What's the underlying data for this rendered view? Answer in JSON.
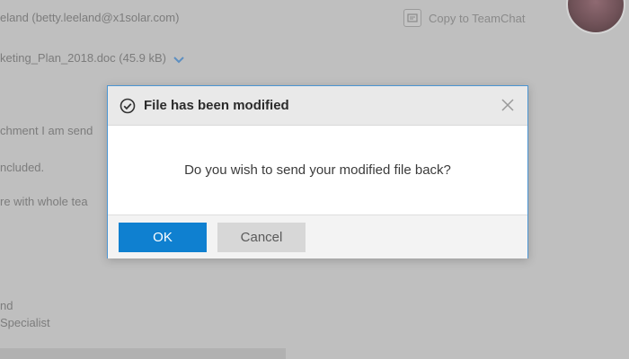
{
  "email": {
    "sender": "eland (betty.leeland@x1solar.com)",
    "copy_to_teamchat_label": "Copy to TeamChat",
    "attachment": "keting_Plan_2018.doc (45.9 kB)",
    "body_lines": [
      "chment I am send",
      "ncluded.",
      "re with whole tea"
    ],
    "signature_lines": [
      "nd",
      "Specialist"
    ]
  },
  "dialog": {
    "title": "File has been modified",
    "message": "Do you wish to send your modified file back?",
    "ok_label": "OK",
    "cancel_label": "Cancel"
  },
  "colors": {
    "primary_button": "#0f80d0",
    "dialog_border": "#4b95d3",
    "overlay": "#bfbfbf"
  },
  "icons": {
    "check": "check-circle-icon",
    "close": "close-icon",
    "dropdown": "chevron-down-icon",
    "copy": "teamchat-icon"
  }
}
